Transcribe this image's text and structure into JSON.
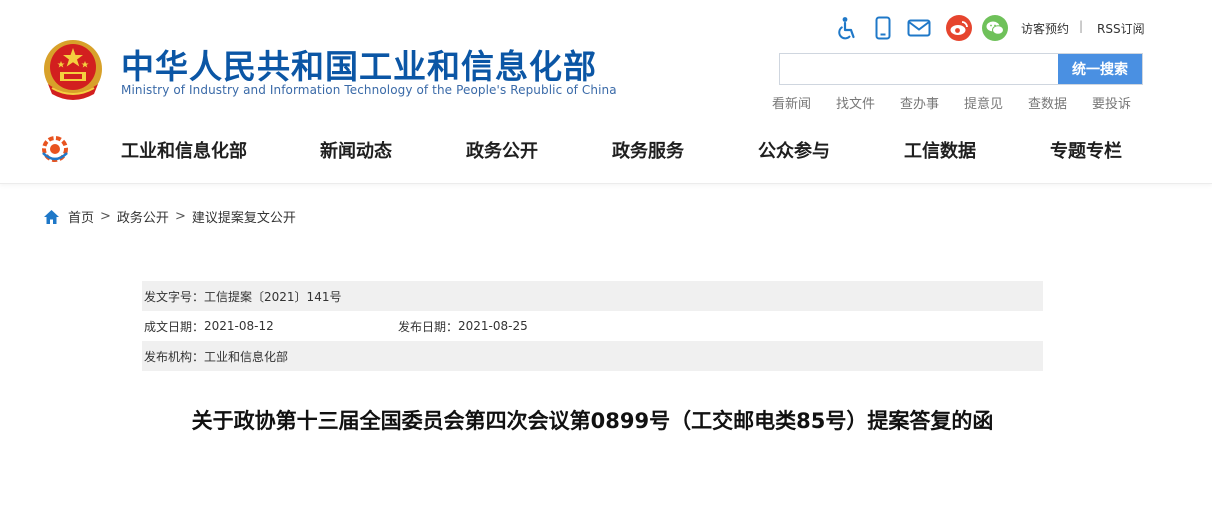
{
  "header": {
    "title_cn": "中华人民共和国工业和信息化部",
    "title_en": "Ministry of Industry and Information Technology of the People's Republic of China",
    "emblem_icon": "national-emblem-icon"
  },
  "toolbar": {
    "icons": [
      "accessibility-icon",
      "mobile-icon",
      "mail-icon",
      "weibo-icon",
      "wechat-icon"
    ],
    "visitor_booking": "访客预约",
    "separator": "|",
    "rss": "RSS订阅"
  },
  "search": {
    "placeholder": "",
    "button_label": "统一搜索"
  },
  "quick_links": [
    "看新闻",
    "找文件",
    "查办事",
    "提意见",
    "查数据",
    "要投诉"
  ],
  "nav": {
    "logo_icon": "miit-logo-icon",
    "items": [
      "工业和信息化部",
      "新闻动态",
      "政务公开",
      "政务服务",
      "公众参与",
      "工信数据",
      "专题专栏"
    ]
  },
  "breadcrumb": {
    "home_icon": "home-icon",
    "items": [
      "首页",
      "政务公开",
      "建议提案复文公开"
    ],
    "separator": ">"
  },
  "meta": {
    "doc_number_label": "发文字号：",
    "doc_number_value": "工信提案〔2021〕141号",
    "created_label": "成文日期：",
    "created_value": "2021-08-12",
    "published_label": "发布日期：",
    "published_value": "2021-08-25",
    "issuer_label": "发布机构：",
    "issuer_value": "工业和信息化部"
  },
  "article": {
    "title": "关于政协第十三届全国委员会第四次会议第0899号（工交邮电类85号）提案答复的函"
  },
  "colors": {
    "brand_blue": "#0b56a5",
    "search_button": "#4a90e2",
    "weibo": "#e6452e",
    "wechat": "#6fc15a",
    "icon_blue": "#1f78c8"
  }
}
